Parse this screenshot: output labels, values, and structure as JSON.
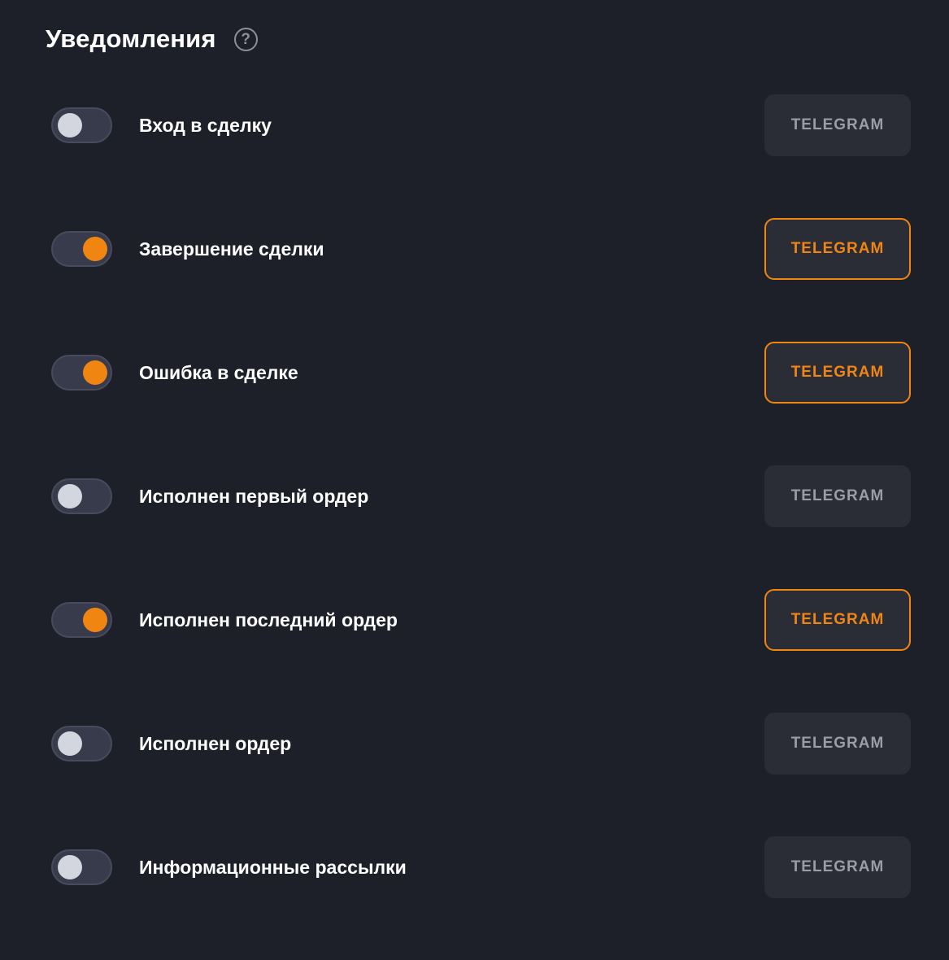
{
  "header": {
    "title": "Уведомления",
    "help_symbol": "?"
  },
  "colors": {
    "background": "#1e2029",
    "accent": "#f08512",
    "toggle_off_knob": "#d3d6de",
    "button_bg": "#2a2c36",
    "button_off_text": "#9a9ca8"
  },
  "notifications": [
    {
      "label": "Вход в сделку",
      "enabled": false,
      "channel_label": "TELEGRAM"
    },
    {
      "label": "Завершение сделки",
      "enabled": true,
      "channel_label": "TELEGRAM"
    },
    {
      "label": "Ошибка в сделке",
      "enabled": true,
      "channel_label": "TELEGRAM"
    },
    {
      "label": "Исполнен первый ордер",
      "enabled": false,
      "channel_label": "TELEGRAM"
    },
    {
      "label": "Исполнен последний ордер",
      "enabled": true,
      "channel_label": "TELEGRAM"
    },
    {
      "label": "Исполнен ордер",
      "enabled": false,
      "channel_label": "TELEGRAM"
    },
    {
      "label": "Информационные рассылки",
      "enabled": false,
      "channel_label": "TELEGRAM"
    }
  ]
}
